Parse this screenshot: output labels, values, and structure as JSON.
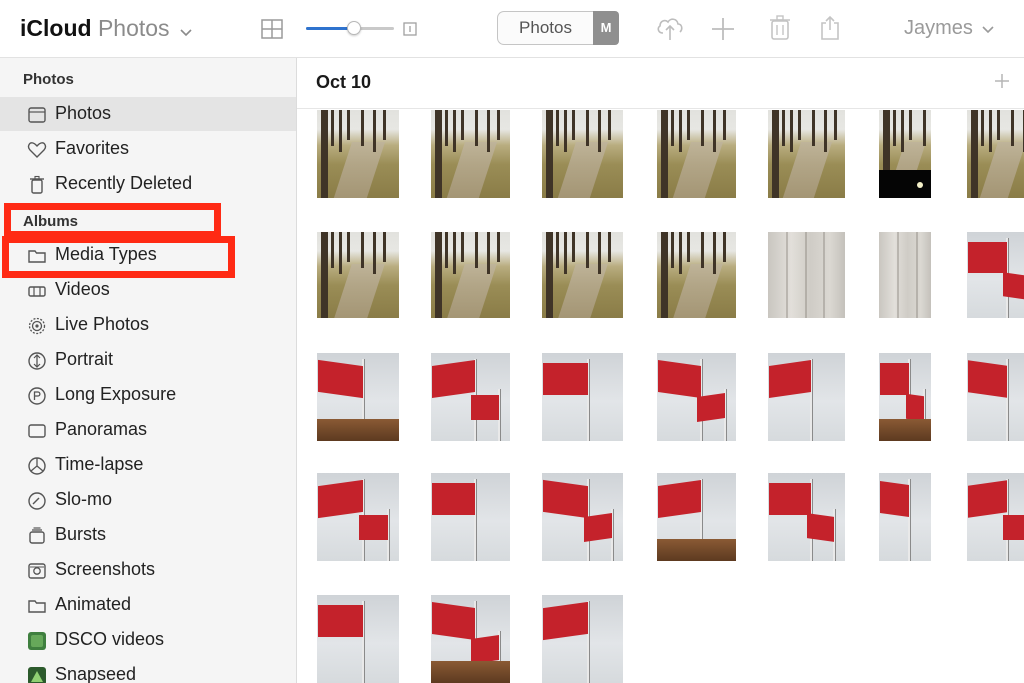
{
  "topbar": {
    "brand_primary": "iCloud",
    "brand_secondary": "Photos",
    "segment_label": "Photos",
    "segment_badge": "M",
    "zoom_slider_level": 0.55,
    "user_name": "Jaymes"
  },
  "sidebar": {
    "photos_section_title": "Photos",
    "albums_section_title": "Albums",
    "items": [
      {
        "label": "Photos",
        "icon": "photos-icon",
        "selected": true
      },
      {
        "label": "Favorites",
        "icon": "heart-icon"
      },
      {
        "label": "Recently Deleted",
        "icon": "trash-icon"
      },
      {
        "label": "Media Types",
        "icon": "folder-icon"
      },
      {
        "label": "Videos",
        "icon": "video-icon"
      },
      {
        "label": "Live Photos",
        "icon": "live-photo-icon"
      },
      {
        "label": "Portrait",
        "icon": "portrait-icon"
      },
      {
        "label": "Long Exposure",
        "icon": "long-exposure-icon"
      },
      {
        "label": "Panoramas",
        "icon": "panorama-icon"
      },
      {
        "label": "Time-lapse",
        "icon": "timelapse-icon"
      },
      {
        "label": "Slo-mo",
        "icon": "slomo-icon"
      },
      {
        "label": "Bursts",
        "icon": "bursts-icon"
      },
      {
        "label": "Screenshots",
        "icon": "screenshot-icon"
      },
      {
        "label": "Animated",
        "icon": "folder-icon"
      },
      {
        "label": "DSCO videos",
        "icon": "dsco-app-icon"
      },
      {
        "label": "Snapseed",
        "icon": "snapseed-app-icon"
      }
    ]
  },
  "main": {
    "date_heading": "Oct 10",
    "rows": [
      [
        "park",
        "park",
        "park",
        "park",
        "park",
        "park-night",
        "park"
      ],
      [
        "park",
        "park",
        "park",
        "park",
        "concrete",
        "concrete",
        "flag"
      ],
      [
        "flag",
        "flag",
        "flag",
        "flag",
        "flag",
        "flag",
        "flag"
      ],
      [
        "flag",
        "flag",
        "flag",
        "flag",
        "flag",
        "flag",
        "flag"
      ],
      [
        "flag",
        "flag",
        "flag"
      ]
    ]
  },
  "colors": {
    "accent": "#2f73ce",
    "highlight": "#ff2a14",
    "sidebar_bg": "#f5f5f5",
    "selected_bg": "#e4e4e4"
  }
}
